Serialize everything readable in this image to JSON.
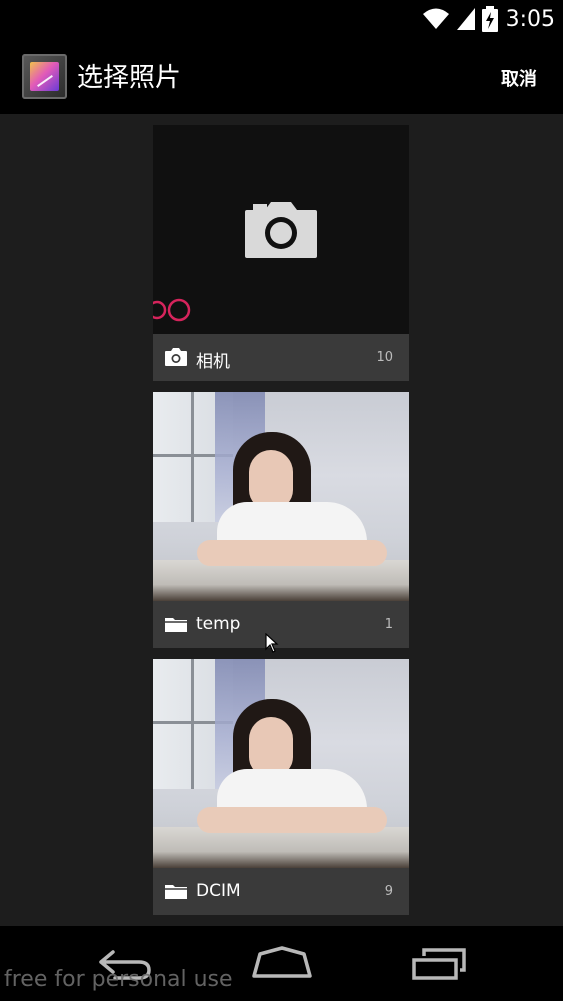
{
  "status_bar": {
    "time": "3:05",
    "icons": [
      "wifi-icon",
      "signal-icon",
      "battery-charging-icon"
    ]
  },
  "action_bar": {
    "app_icon": "gallery-app-icon",
    "title": "选择照片",
    "cancel_label": "取消"
  },
  "albums": [
    {
      "name": "相机",
      "count": "10",
      "icon": "camera-icon",
      "thumbnail": "camera-placeholder"
    },
    {
      "name": "temp",
      "count": "1",
      "icon": "folder-icon",
      "thumbnail": "photo-portrait"
    },
    {
      "name": "DCIM",
      "count": "9",
      "icon": "folder-icon",
      "thumbnail": "photo-portrait"
    }
  ],
  "nav_bar": {
    "buttons": [
      "back-icon",
      "home-icon",
      "recents-icon"
    ]
  },
  "watermark": "free for personal use",
  "colors": {
    "background": "#1d1d1d",
    "caption_bg": "#3a3a3a",
    "bars": "#000000",
    "brand_mark": "#d6245c"
  }
}
